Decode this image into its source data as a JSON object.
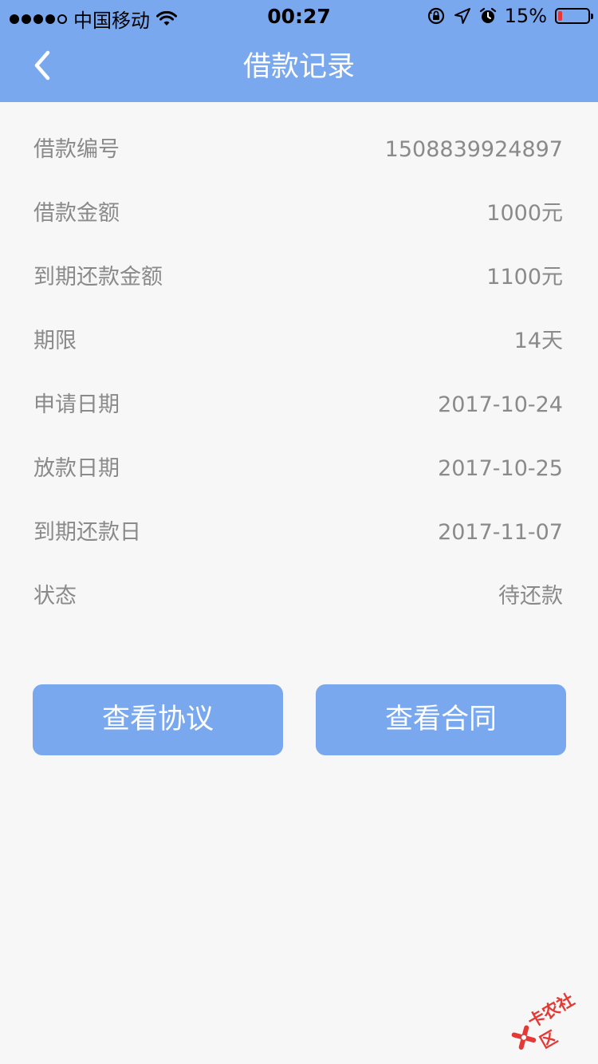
{
  "status_bar": {
    "carrier": "中国移动",
    "time": "00:27",
    "battery_percent": "15%",
    "battery_level": 0.15,
    "icons": [
      "signal-dots-icon",
      "wifi-icon",
      "rotation-lock-icon",
      "location-arrow-icon",
      "alarm-icon",
      "battery-icon"
    ]
  },
  "nav": {
    "title": "借款记录",
    "back_icon": "chevron-left-icon"
  },
  "details": [
    {
      "label": "借款编号",
      "value": "1508839924897"
    },
    {
      "label": "借款金额",
      "value": "1000元"
    },
    {
      "label": "到期还款金额",
      "value": "1100元"
    },
    {
      "label": "期限",
      "value": "14天"
    },
    {
      "label": "申请日期",
      "value": "2017-10-24"
    },
    {
      "label": "放款日期",
      "value": "2017-10-25"
    },
    {
      "label": "到期还款日",
      "value": "2017-11-07"
    },
    {
      "label": "状态",
      "value": "待还款"
    }
  ],
  "actions": {
    "view_agreement": "查看协议",
    "view_contract": "查看合同"
  },
  "watermark": {
    "text": "卡农社区",
    "icon": "kanong-logo-icon"
  },
  "colors": {
    "accent": "#79a8ef",
    "background": "#f7f7f7",
    "text_muted": "#8a8a8a",
    "battery_low": "#e53935"
  }
}
